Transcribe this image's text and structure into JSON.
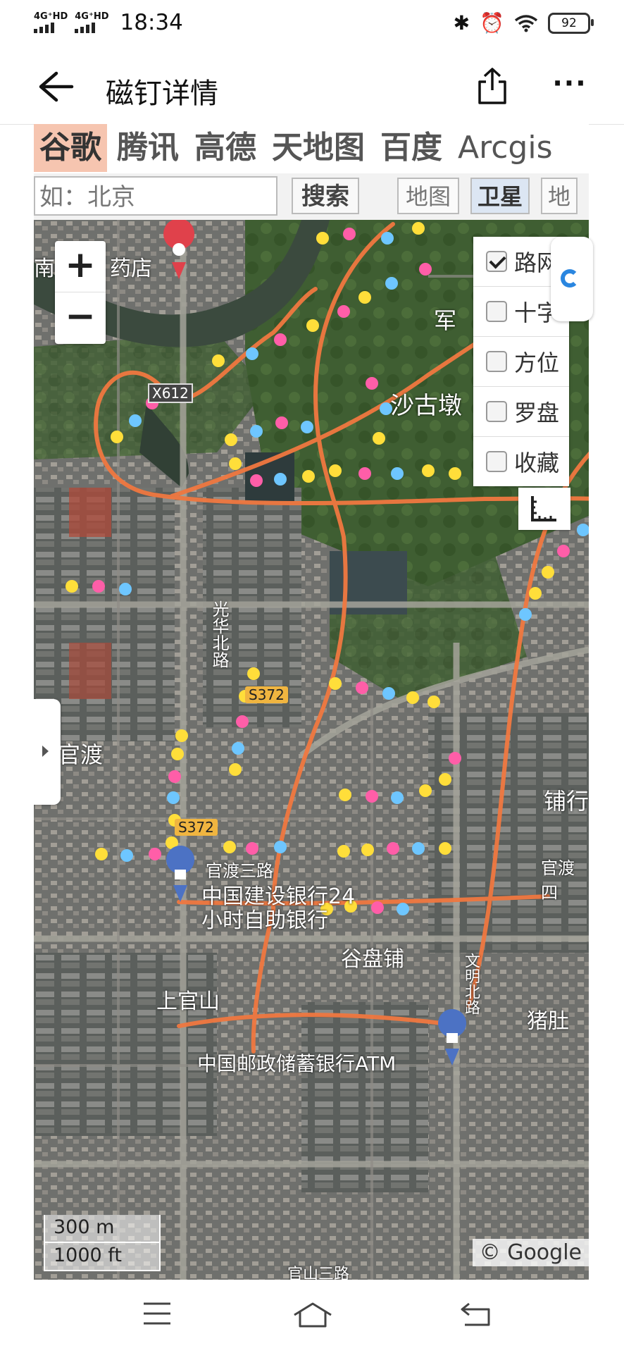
{
  "status_bar": {
    "network_1": "4G⁺HD",
    "network_2": "4G⁺HD",
    "time": "18:34",
    "battery": "92"
  },
  "app_bar": {
    "title": "磁钉详情"
  },
  "map_tabs": [
    "谷歌",
    "腾讯",
    "高德",
    "天地图",
    "百度",
    "Arcgis"
  ],
  "search": {
    "placeholder": "如：北京",
    "button": "搜索"
  },
  "map_types": [
    "地图",
    "卫星",
    "地"
  ],
  "layers": [
    {
      "label": "路网",
      "checked": true
    },
    {
      "label": "十字",
      "checked": false
    },
    {
      "label": "方位",
      "checked": false
    },
    {
      "label": "罗盘",
      "checked": false
    },
    {
      "label": "收藏",
      "checked": false
    }
  ],
  "zoom": {
    "in": "+",
    "out": "−"
  },
  "map_labels": {
    "pharmacy": "药店",
    "nan": "南",
    "x612": "X612",
    "jun": "军",
    "shagudun": "沙古墩",
    "guanghua": "光华北路",
    "s372a": "S372",
    "s372b": "S372",
    "guandu": "官渡",
    "puhang": "铺行",
    "guandu_road": "官渡三路",
    "guandu_right": "官渡四",
    "ccb": "中国建设银行24小时自助银行",
    "gupan": "谷盘铺",
    "shangguanshan": "上官山",
    "zhudu": "猪肚",
    "wenming": "文明北路",
    "psbc": "中国邮政储蓄银行ATM",
    "bottom_road": "官山三路"
  },
  "scale": {
    "metric": "300 m",
    "imperial": "1000 ft"
  },
  "copyright": "© Google",
  "colors": {
    "track": "#f07840",
    "tab_active": "#f6c5b0",
    "satellite_on": "#dce6f3"
  }
}
